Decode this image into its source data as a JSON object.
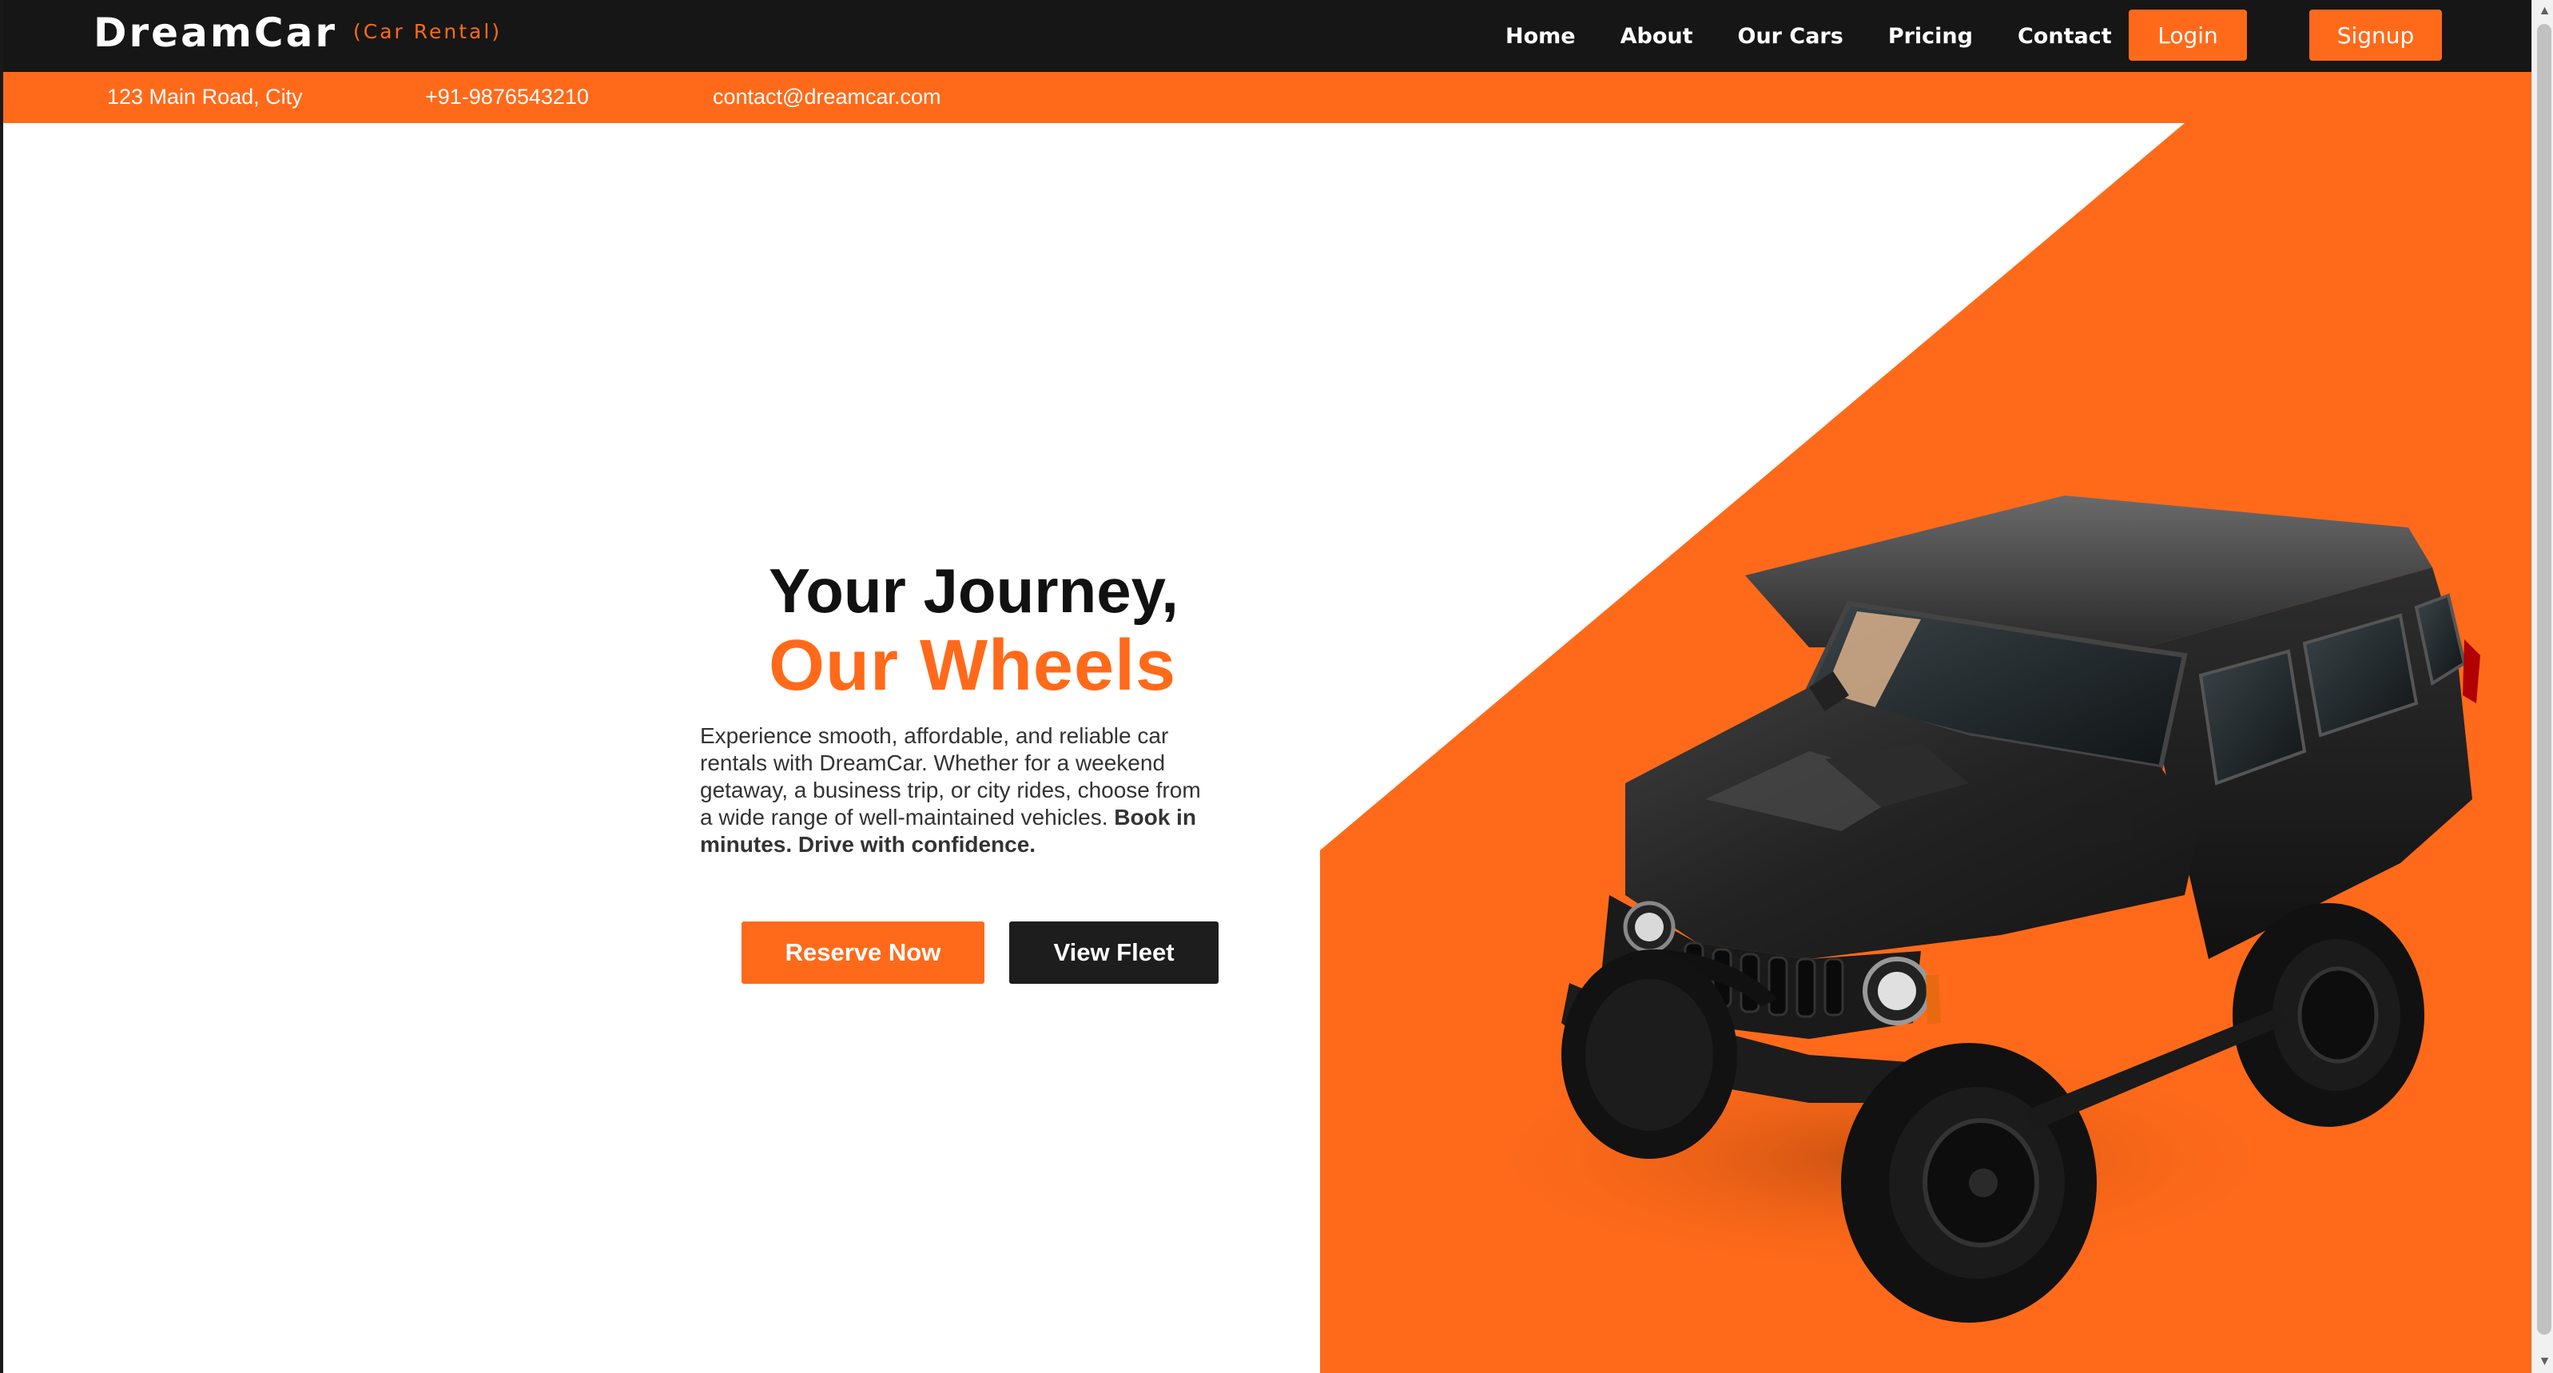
{
  "brand": {
    "name": "DreamCar",
    "subtitle": "(Car Rental)"
  },
  "nav": {
    "links": [
      "Home",
      "About",
      "Our Cars",
      "Pricing",
      "Contact"
    ],
    "login_label": "Login",
    "signup_label": "Signup"
  },
  "info": {
    "address": "123 Main Road, City",
    "phone": "+91-9876543210",
    "email": "contact@dreamcar.com"
  },
  "hero": {
    "headline_line1": "Your Journey,",
    "headline_line2": "Our Wheels",
    "description": "Experience smooth, affordable, and reliable car rentals with DreamCar. Whether for a weekend getaway, a business trip, or city rides, choose from a wide range of well-maintained vehicles.",
    "description_emphasis": "Book in minutes. Drive with confidence.",
    "reserve_label": "Reserve Now",
    "fleet_label": "View Fleet",
    "image_subject": "black-suv"
  },
  "colors": {
    "accent": "#ff6a1a",
    "navbar": "#161616",
    "dark_button": "#1d1d1d",
    "background": "#ffffff"
  },
  "icons": {
    "scroll_up": "triangle-up-icon",
    "scroll_down": "triangle-down-icon"
  }
}
